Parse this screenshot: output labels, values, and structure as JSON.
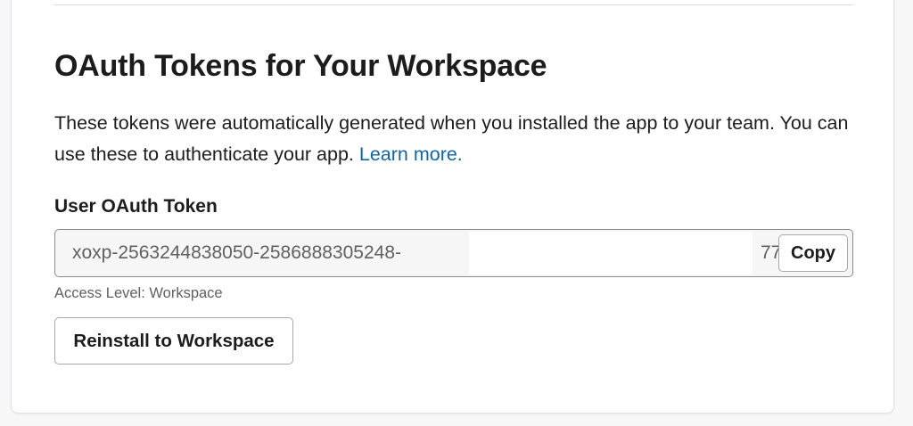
{
  "section": {
    "title": "OAuth Tokens for Your Workspace",
    "description": "These tokens were automatically generated when you installed the app to your team. You can use these to authenticate your app.",
    "learn_more_label": "Learn more."
  },
  "token": {
    "label": "User OAuth Token",
    "value_visible": "xoxp-2563244838050-2586888305248-",
    "value_tail": "77",
    "copy_label": "Copy",
    "access_level": "Access Level: Workspace"
  },
  "actions": {
    "reinstall_label": "Reinstall to Workspace"
  },
  "colors": {
    "link": "#1264a3",
    "text": "#1d1c1d",
    "muted": "#616061",
    "field_bg": "#f6f6f6"
  }
}
